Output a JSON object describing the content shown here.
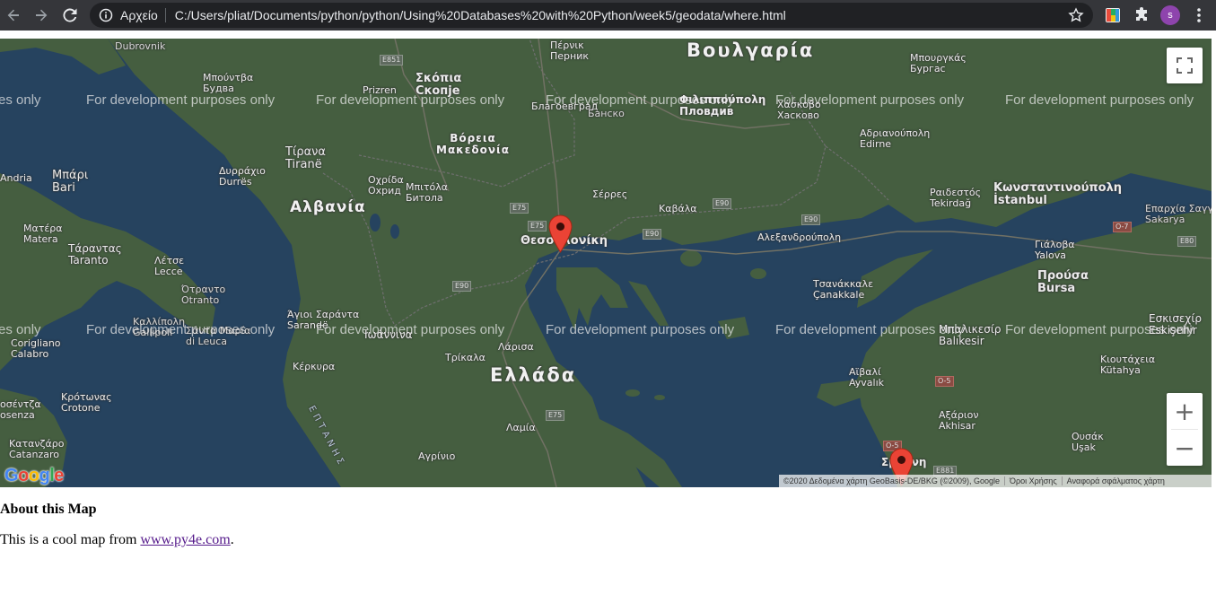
{
  "browser": {
    "scheme_label": "Αρχείο",
    "url": "C:/Users/pliat/Documents/python/python/Using%20Databases%20with%20Python/week5/geodata/where.html",
    "profile_initial": "s",
    "accent": "#8e44ad"
  },
  "map": {
    "watermark": "For development purposes only",
    "watermark_cut": "es only",
    "countries": [
      "Βουλγαρία",
      "Αλβανία",
      "Ελλάδα"
    ],
    "region_top": "Βόρεια",
    "region_bottom": "Μακεδονία",
    "sea": "ΕΠΤΑΝΗΣ",
    "cities": {
      "dubrovnik": "Dubrovnik",
      "skopje_gr": "Σκόπια",
      "skopje": "Скопје",
      "pernik_gr": "Πέρνικ",
      "pernik": "Перник",
      "blagoevgrad": "Благоевград",
      "bansko": "Банско",
      "plovdiv_gr": "Φιλιππούπολη",
      "plovdiv": "Пловдив",
      "haskovo_gr": "Χάσκοβο",
      "haskovo": "Хасково",
      "burgas_gr": "Μπουργκάς",
      "burgas": "Бургас",
      "edirne_gr": "Αδριανούπολη",
      "edirne": "Edirne",
      "prizren": "Prizren",
      "budva_gr": "Μπούντβα",
      "budva": "Будва",
      "tirana_gr": "Τίρανα",
      "tirana": "Tiranë",
      "durres_gr": "Δυρράχιο",
      "durres": "Durrës",
      "bari_gr": "Μπάρι",
      "bari": "Bari",
      "andria": "Andria",
      "ohrid_gr": "Οχρίδα",
      "ohrid": "Охрид",
      "bitola_gr": "Μπιτόλα",
      "bitola": "Битола",
      "serres": "Σέρρες",
      "kavala": "Καβάλα",
      "thessaloniki": "Θεσσαλονίκη",
      "alexandroupoli": "Αλεξανδρούπολη",
      "tekirdag_gr": "Ραιδεστός",
      "tekirdag": "Tekirdağ",
      "istanbul_gr": "Κωνσταντινούπολη",
      "istanbul": "İstanbul",
      "sakarya_gr": "Επαρχία Σαγγάριου",
      "sakarya": "Sakarya",
      "yalova_gr": "Γιάλοβα",
      "yalova": "Yalova",
      "bursa_gr": "Προύσα",
      "bursa": "Bursa",
      "matera_gr": "Ματέρα",
      "matera": "Matera",
      "taranto_gr": "Τάραντας",
      "taranto": "Taranto",
      "lecce_gr": "Λέτσε",
      "lecce": "Lecce",
      "otranto_gr": "Ότραντο",
      "otranto": "Otranto",
      "gallipoli_gr": "Καλλίπολη",
      "gallipoli": "Gallipoli",
      "sarande_gr": "Άγιοι Σαράντα",
      "sarande": "Sarandë",
      "santamaria_gr": "Σάντα Μαρία",
      "santamaria": "di Leuca",
      "corigliano": "Corigliano",
      "calabro": "Calabro",
      "ioannina": "Ιωάννινα",
      "larissa": "Λάρισα",
      "trikala": "Τρίκαλα",
      "kerkyra": "Κέρκυρα",
      "canakkale_gr": "Τσανάκκαλε",
      "canakkale": "Çanakkale",
      "balikesir_gr": "Μπαλικεσίρ",
      "balikesir": "Balıkesir",
      "eskisehir_gr": "Εσκισεχίρ",
      "eskisehir": "Eskişehir",
      "kutahya_gr": "Κιουτάχεια",
      "kutahya": "Kütahya",
      "ayvalik_gr": "Αϊβαλί",
      "ayvalik": "Ayvalık",
      "akhisar_gr": "Αξάριον",
      "akhisar": "Akhisar",
      "usak_gr": "Ουσάκ",
      "usak": "Uşak",
      "crotone_gr": "Κρότωνας",
      "crotone": "Crotone",
      "cosenza_gr": "οσέντζα",
      "cosenza": "osenza",
      "catanzaro_gr": "Κατανζάρο",
      "catanzaro": "Catanzaro",
      "lamia": "Λαμία",
      "agrinio": "Αγρίνιο",
      "smyrna": "Σμύρνη"
    },
    "roads": [
      "E851",
      "E75",
      "E75",
      "E90",
      "E90",
      "E90",
      "E90",
      "E75",
      "O-7",
      "E80",
      "O-5",
      "O-5",
      "E881"
    ],
    "attribution": [
      "©2020 Δεδομένα χάρτη GeoBasis-DE/BKG (©2009), Google",
      "Όροι Χρήσης",
      "Αναφορά σφάλματος χάρτη"
    ],
    "google_logo": "Google",
    "zoom_in": "+",
    "zoom_out": "−"
  },
  "page": {
    "about_title": "About this Map",
    "text_prefix": "This is a cool map from ",
    "link_text": "www.py4e.com",
    "text_suffix": "."
  }
}
